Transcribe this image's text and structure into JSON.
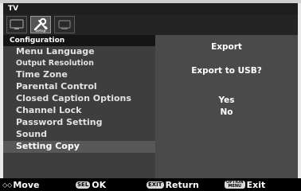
{
  "window": {
    "title": "TV"
  },
  "tabs": [
    {
      "icon": "tv-monitor-icon",
      "label": ""
    },
    {
      "icon": "tools-icon",
      "label": "Setup"
    },
    {
      "icon": "screen-icon",
      "label": ""
    }
  ],
  "left_panel": {
    "header": "Configuration",
    "items": [
      {
        "label": "Menu Language"
      },
      {
        "label": "Output Resolution"
      },
      {
        "label": "Time Zone"
      },
      {
        "label": "Parental Control"
      },
      {
        "label": "Closed Caption Options"
      },
      {
        "label": "Channel Lock"
      },
      {
        "label": "Password Setting"
      },
      {
        "label": "Sound"
      },
      {
        "label": "Setting Copy"
      }
    ],
    "selected_index": 8
  },
  "right_panel": {
    "title": "Export",
    "question": "Export to USB?",
    "options": [
      "Yes",
      "No"
    ]
  },
  "footer": {
    "move": {
      "key": "◇◇",
      "label": "Move"
    },
    "ok": {
      "key": "SEL",
      "label": "OK"
    },
    "return": {
      "key": "EXIT",
      "label": "Return"
    },
    "exit": {
      "key_top": "OPTION",
      "key_bottom": "MENU",
      "label": "Exit"
    }
  },
  "colors": {
    "title_bar": "#1e1e1e",
    "left_panel": "#3e3e3e",
    "right_panel": "#4a4a4a",
    "selected_row": "#585858",
    "footer": "#000000"
  }
}
